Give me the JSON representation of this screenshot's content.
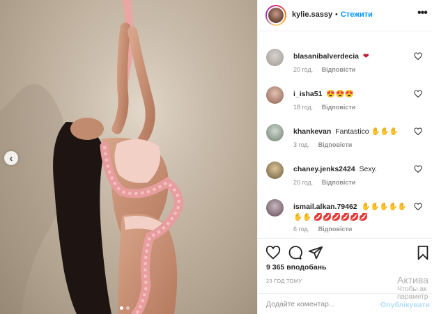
{
  "post": {
    "image_alt": "",
    "slide_count": 2,
    "active_slide": 1
  },
  "header": {
    "username": "kylie.sassy",
    "separator": "•",
    "follow_label": "Стежити",
    "more_icon": "more-horizontal-icon"
  },
  "comments": [
    {
      "username": "blasanibalverdecia",
      "text": "❤",
      "time": "20 год.",
      "reply_label": "Відповісти"
    },
    {
      "username": "i_isha51",
      "text": "😍😍😍",
      "time": "18 год.",
      "reply_label": "Відповісти"
    },
    {
      "username": "khankevan",
      "text": "Fantastico ✋✋✋",
      "time": "3 год.",
      "reply_label": "Відповісти"
    },
    {
      "username": "chaney.jenks2424",
      "text": "Sexy.",
      "time": "20 год.",
      "reply_label": "Відповісти"
    },
    {
      "username": "ismail.alkan.79462",
      "text": "✋✋✋✋✋✋✋ 💋💋💋💋💋💋",
      "time": "6 год.",
      "reply_label": "Відповісти"
    }
  ],
  "actions": {
    "likes_text": "9 365 вподобань",
    "posted_text": "23 ГОД ТОМУ"
  },
  "add_comment": {
    "placeholder": "Додайте коментар...",
    "publish_label": "Опублікувати"
  },
  "watermark": {
    "title": "Актива",
    "line1": "Чтобы ак",
    "line2": "параметр"
  },
  "colors": {
    "accent": "#0095f6",
    "heart": "#ed4956",
    "muted": "#8e8e8e"
  }
}
